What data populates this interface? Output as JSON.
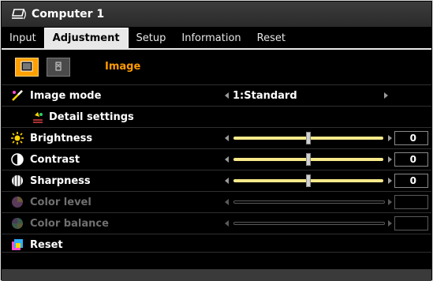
{
  "window": {
    "title": "Computer 1",
    "icon": "pc-input-icon"
  },
  "tabs": [
    {
      "label": "Input",
      "active": false
    },
    {
      "label": "Adjustment",
      "active": true
    },
    {
      "label": "Setup",
      "active": false
    },
    {
      "label": "Information",
      "active": false
    },
    {
      "label": "Reset",
      "active": false
    }
  ],
  "submenu": {
    "label": "Image",
    "accent": "#ff9a00"
  },
  "rows": {
    "image_mode": {
      "label": "Image mode",
      "value": "1:Standard"
    },
    "detail": {
      "label": "Detail settings"
    },
    "brightness": {
      "label": "Brightness",
      "value": "0",
      "level": 0.5
    },
    "contrast": {
      "label": "Contrast",
      "value": "0",
      "level": 0.5
    },
    "sharpness": {
      "label": "Sharpness",
      "value": "0",
      "level": 0.5
    },
    "color_level": {
      "label": "Color level",
      "value": ""
    },
    "color_balance": {
      "label": "Color balance",
      "value": ""
    },
    "reset": {
      "label": "Reset"
    }
  }
}
